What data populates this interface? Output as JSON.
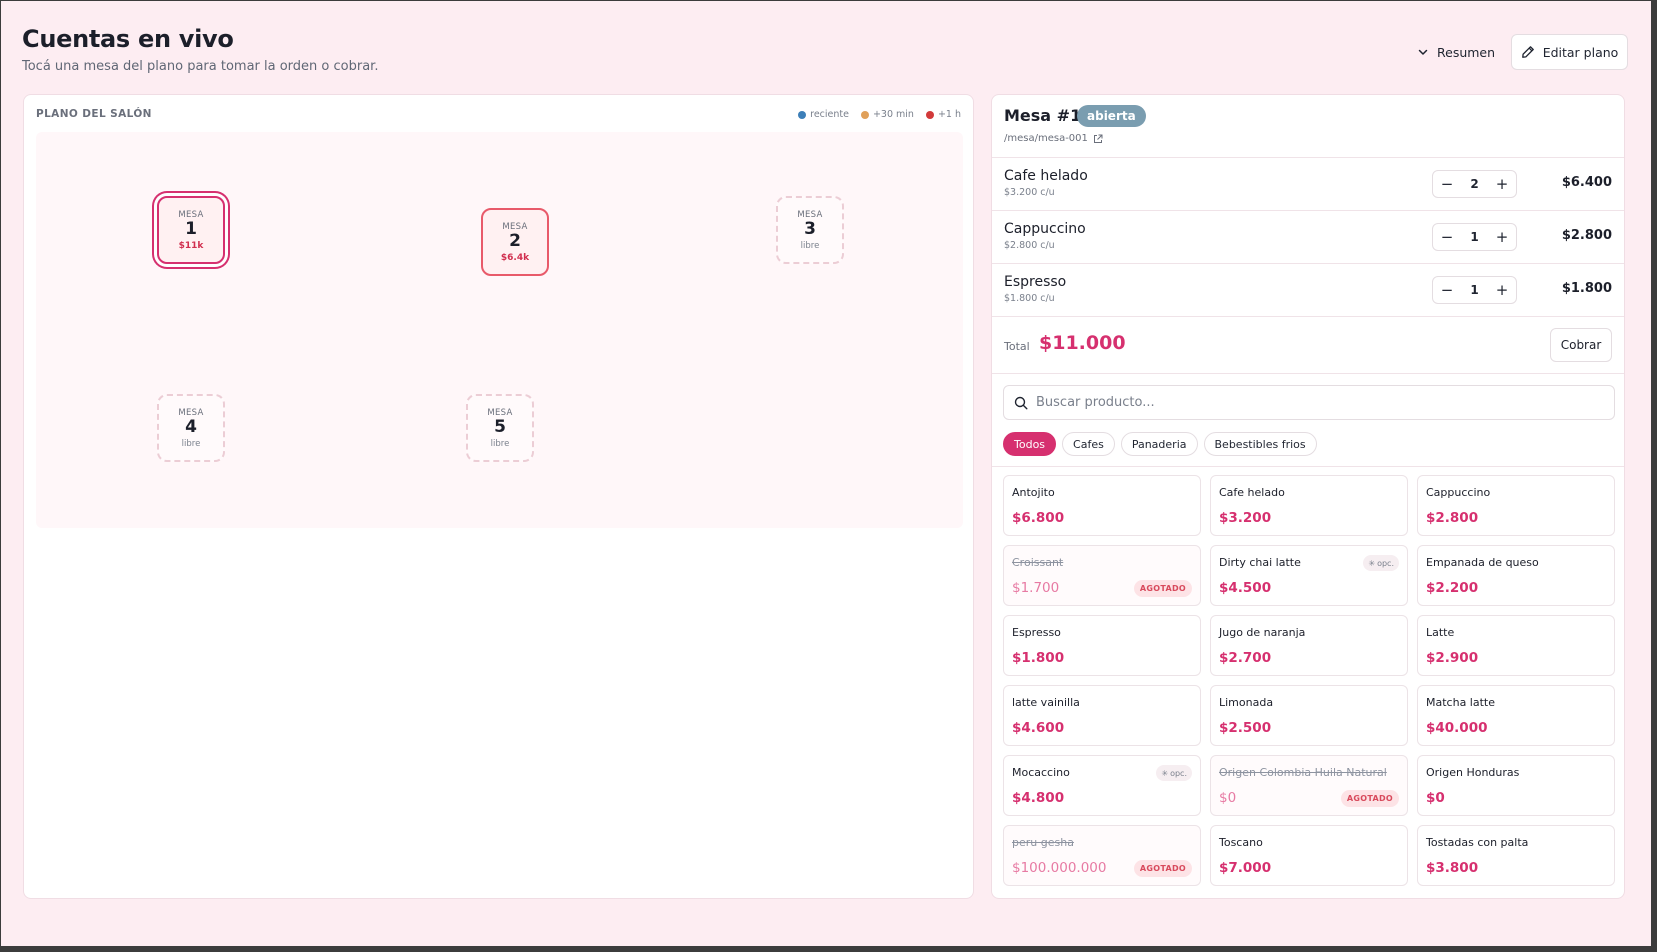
{
  "header": {
    "title": "Cuentas en vivo",
    "subtitle": "Tocá una mesa del plano para tomar la orden o cobrar.",
    "resumen_label": "Resumen",
    "editar_label": "Editar plano"
  },
  "floor": {
    "title": "PLANO DEL SALÓN",
    "legend": [
      {
        "label": "reciente",
        "color": "#3d7fb8"
      },
      {
        "label": "+30 min",
        "color": "#e0a05a"
      },
      {
        "label": "+1 h",
        "color": "#d23a3a"
      }
    ],
    "tables": [
      {
        "label": "MESA",
        "number": "1",
        "amount": "$11k",
        "state": "selected"
      },
      {
        "label": "MESA",
        "number": "2",
        "amount": "$6.4k",
        "state": "occupied"
      },
      {
        "label": "MESA",
        "number": "3",
        "status": "libre",
        "state": "free"
      },
      {
        "label": "MESA",
        "number": "4",
        "status": "libre",
        "state": "free"
      },
      {
        "label": "MESA",
        "number": "5",
        "status": "libre",
        "state": "free"
      }
    ]
  },
  "order": {
    "title": "Mesa #1",
    "badge": "abierta",
    "link": "/mesa/mesa-001",
    "items": [
      {
        "name": "Cafe helado",
        "unit": "$3.200 c/u",
        "qty": "2",
        "total": "$6.400"
      },
      {
        "name": "Cappuccino",
        "unit": "$2.800 c/u",
        "qty": "1",
        "total": "$2.800"
      },
      {
        "name": "Espresso",
        "unit": "$1.800 c/u",
        "qty": "1",
        "total": "$1.800"
      }
    ],
    "minus": "−",
    "plus": "+",
    "total_label": "Total",
    "total_amount": "$11.000",
    "cobrar_label": "Cobrar"
  },
  "catalog": {
    "search_placeholder": "Buscar producto...",
    "tabs": [
      "Todos",
      "Cafes",
      "Panaderia",
      "Bebestibles frios"
    ],
    "active_tab": "Todos",
    "products": [
      {
        "name": "Antojito",
        "price": "$6.800"
      },
      {
        "name": "Cafe helado",
        "price": "$3.200"
      },
      {
        "name": "Cappuccino",
        "price": "$2.800"
      },
      {
        "name": "Croissant",
        "price": "$1.700",
        "badge": "AGOTADO",
        "out": true
      },
      {
        "name": "Dirty chai latte",
        "price": "$4.500",
        "opc": "opc."
      },
      {
        "name": "Empanada de queso",
        "price": "$2.200"
      },
      {
        "name": "Espresso",
        "price": "$1.800"
      },
      {
        "name": "Jugo de naranja",
        "price": "$2.700"
      },
      {
        "name": "Latte",
        "price": "$2.900"
      },
      {
        "name": "latte vainilla",
        "price": "$4.600"
      },
      {
        "name": "Limonada",
        "price": "$2.500"
      },
      {
        "name": "Matcha latte",
        "price": "$40.000"
      },
      {
        "name": "Mocaccino",
        "price": "$4.800",
        "opc": "opc."
      },
      {
        "name": "Origen Colombia Huila Natural",
        "price": "$0",
        "badge": "AGOTADO",
        "out": true
      },
      {
        "name": "Origen Honduras",
        "price": "$0"
      },
      {
        "name": "peru gesha",
        "price": "$100.000.000",
        "badge": "AGOTADO",
        "out": true
      },
      {
        "name": "Toscano",
        "price": "$7.000"
      },
      {
        "name": "Tostadas con palta",
        "price": "$3.800"
      }
    ]
  },
  "colors": {
    "accent": "#d6306f",
    "background": "#fdedf2",
    "badge_abierta": "#7a9db0"
  }
}
